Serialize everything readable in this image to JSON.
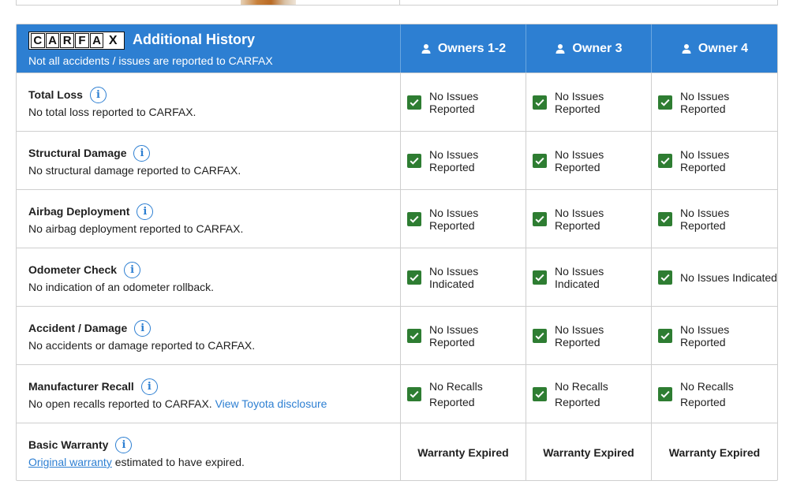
{
  "header": {
    "logo_letters": [
      "C",
      "A",
      "R",
      "F",
      "A",
      "X"
    ],
    "title": "Additional History",
    "subtitle": "Not all accidents / issues are reported to CARFAX",
    "owners": [
      "Owners 1-2",
      "Owner 3",
      "Owner 4"
    ]
  },
  "rows": [
    {
      "title": "Total Loss",
      "desc": "No total loss reported to CARFAX.",
      "status": [
        "No Issues Reported",
        "No Issues Reported",
        "No Issues Reported"
      ]
    },
    {
      "title": "Structural Damage",
      "desc": "No structural damage reported to CARFAX.",
      "status": [
        "No Issues Reported",
        "No Issues Reported",
        "No Issues Reported"
      ]
    },
    {
      "title": "Airbag Deployment",
      "desc": "No airbag deployment reported to CARFAX.",
      "status": [
        "No Issues Reported",
        "No Issues Reported",
        "No Issues Reported"
      ]
    },
    {
      "title": "Odometer Check",
      "desc": "No indication of an odometer rollback.",
      "status": [
        "No Issues Indicated",
        "No Issues Indicated",
        "No Issues Indicated"
      ]
    },
    {
      "title": "Accident / Damage",
      "desc": "No accidents or damage reported to CARFAX.",
      "status": [
        "No Issues Reported",
        "No Issues Reported",
        "No Issues Reported"
      ]
    },
    {
      "title": "Manufacturer Recall",
      "desc": "No open recalls reported to CARFAX.",
      "desc_link": "View Toyota disclosure",
      "status_line1": "No Recalls",
      "status_line2": "Reported"
    },
    {
      "title": "Basic Warranty",
      "desc_link": "Original warranty",
      "desc_after": "estimated to have expired.",
      "status": [
        "Warranty Expired",
        "Warranty Expired",
        "Warranty Expired"
      ]
    }
  ],
  "icons": {
    "info": "info-circle-icon",
    "check": "checkbox-checked-icon",
    "owner": "person-icon"
  },
  "colors": {
    "header_bg": "#2d7fd2",
    "check_green": "#2e7d32",
    "link_blue": "#2d7fd2"
  }
}
